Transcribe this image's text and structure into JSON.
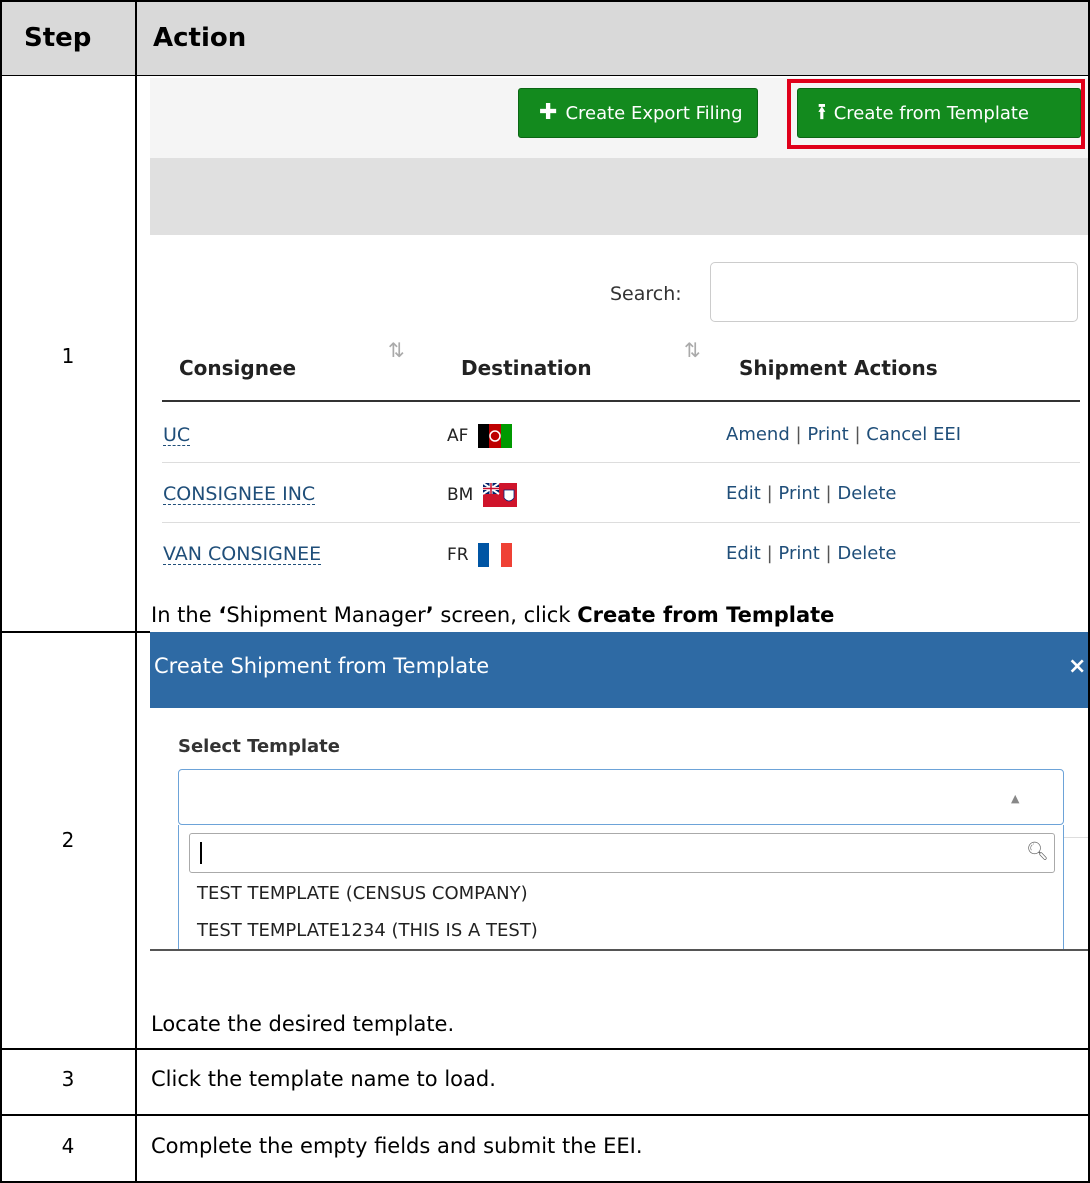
{
  "header": {
    "step": "Step",
    "action": "Action"
  },
  "steps": [
    {
      "number": "1",
      "caption_pre": "In the ",
      "caption_quote_open": "‘",
      "caption_mid": "Shipment Manager",
      "caption_quote_close": "’",
      "caption_post": " screen, click ",
      "caption_bold": "Create from Template"
    },
    {
      "number": "2",
      "caption": "Locate the desired template."
    },
    {
      "number": "3",
      "caption": "Click the template name to load."
    },
    {
      "number": "4",
      "caption": "Complete the empty fields and submit the EEI."
    }
  ],
  "shipment_manager": {
    "create_export_button": "Create Export Filing",
    "create_template_button": "Create from Template",
    "search_label": "Search:",
    "search_value": "",
    "columns": [
      "Consignee",
      "Destination",
      "Shipment Actions"
    ],
    "rows": [
      {
        "consignee": "UC",
        "destination": "AF",
        "flag": "afghanistan-flag-icon",
        "actions": [
          "Amend",
          "Print",
          "Cancel EEI"
        ]
      },
      {
        "consignee": "CONSIGNEE INC",
        "destination": "BM",
        "flag": "bermuda-flag-icon",
        "actions": [
          "Edit",
          "Print",
          "Delete"
        ]
      },
      {
        "consignee": "VAN CONSIGNEE",
        "destination": "FR",
        "flag": "france-flag-icon",
        "actions": [
          "Edit",
          "Print",
          "Delete"
        ]
      }
    ],
    "separator": "|"
  },
  "template_modal": {
    "title": "Create Shipment from Template",
    "close": "×",
    "select_label": "Select Template",
    "options": [
      "TEST TEMPLATE (CENSUS COMPANY)",
      "TEST TEMPLATE1234 (THIS IS A TEST)"
    ],
    "search_value": ""
  },
  "colors": {
    "header_bg": "#d9d9d9",
    "button_green": "#138a1e",
    "highlight_red": "#e0001a",
    "modal_blue": "#2e6aa4",
    "link": "#1f4e79"
  }
}
